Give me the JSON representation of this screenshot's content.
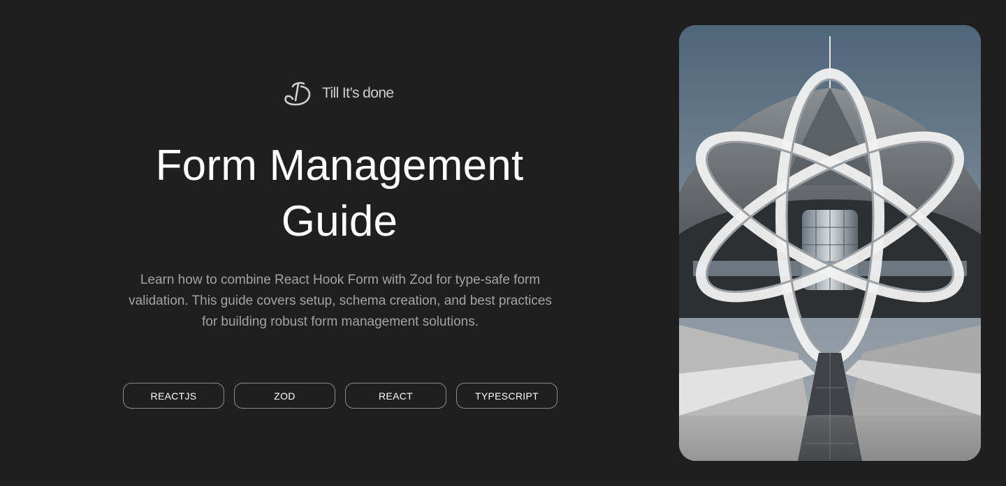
{
  "brand": {
    "name": "Till It’s done",
    "logo_icon": "td-monogram-icon"
  },
  "hero": {
    "title": "Form Management Guide",
    "description": "Learn how to combine React Hook Form with Zod for type-safe form validation. This guide covers setup, schema creation, and best practices for building robust form management solutions."
  },
  "tags": [
    {
      "label": "REACTJS"
    },
    {
      "label": "ZOD"
    },
    {
      "label": "REACT"
    },
    {
      "label": "TYPESCRIPT"
    }
  ],
  "image": {
    "subject": "futuristic-architecture-atom-logo-image"
  },
  "colors": {
    "background": "#1f1f1f",
    "title": "#ffffff",
    "description": "#a3a3a3",
    "tag_border": "#8c8c8c",
    "sky": "#5b6e80"
  }
}
